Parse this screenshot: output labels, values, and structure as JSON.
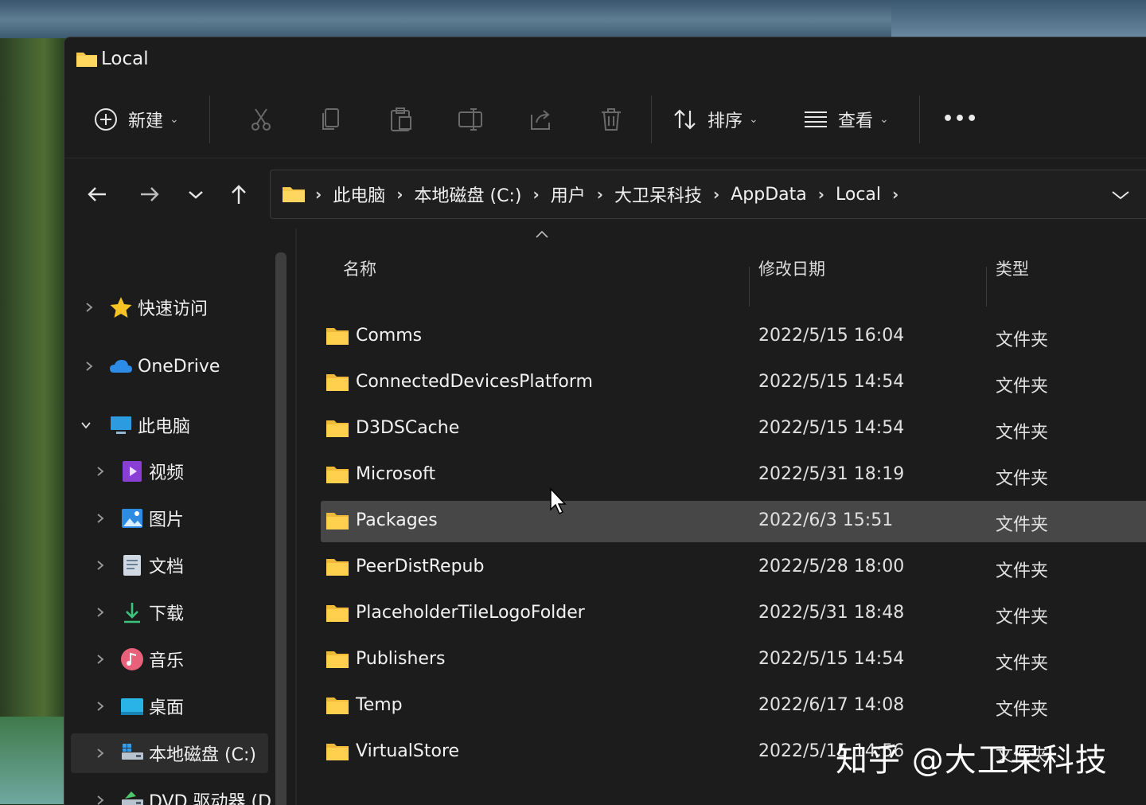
{
  "window": {
    "title": "Local"
  },
  "toolbar": {
    "new_label": "新建",
    "sort_label": "排序",
    "view_label": "查看",
    "more_label": "•••"
  },
  "address": {
    "crumbs": [
      "此电脑",
      "本地磁盘 (C:)",
      "用户",
      "大卫呆科技",
      "AppData",
      "Local"
    ]
  },
  "sidebar": {
    "items": [
      {
        "label": "快速访问",
        "icon": "star-icon"
      },
      {
        "label": "OneDrive",
        "icon": "cloud-icon"
      },
      {
        "label": "此电脑",
        "icon": "pc-icon"
      },
      {
        "label": "视频",
        "icon": "video-icon"
      },
      {
        "label": "图片",
        "icon": "pictures-icon"
      },
      {
        "label": "文档",
        "icon": "documents-icon"
      },
      {
        "label": "下载",
        "icon": "download-icon"
      },
      {
        "label": "音乐",
        "icon": "music-icon"
      },
      {
        "label": "桌面",
        "icon": "desktop-icon"
      },
      {
        "label": "本地磁盘 (C:)",
        "icon": "drive-icon"
      },
      {
        "label": "DVD 驱动器 (D",
        "icon": "dvd-icon"
      }
    ]
  },
  "columns": {
    "name": "名称",
    "modified": "修改日期",
    "type": "类型"
  },
  "files": [
    {
      "name": "Comms",
      "modified": "2022/5/15 16:04",
      "type": "文件夹"
    },
    {
      "name": "ConnectedDevicesPlatform",
      "modified": "2022/5/15 14:54",
      "type": "文件夹"
    },
    {
      "name": "D3DSCache",
      "modified": "2022/5/15 14:54",
      "type": "文件夹"
    },
    {
      "name": "Microsoft",
      "modified": "2022/5/31 18:19",
      "type": "文件夹"
    },
    {
      "name": "Packages",
      "modified": "2022/6/3 15:51",
      "type": "文件夹"
    },
    {
      "name": "PeerDistRepub",
      "modified": "2022/5/28 18:00",
      "type": "文件夹"
    },
    {
      "name": "PlaceholderTileLogoFolder",
      "modified": "2022/5/31 18:48",
      "type": "文件夹"
    },
    {
      "name": "Publishers",
      "modified": "2022/5/15 14:54",
      "type": "文件夹"
    },
    {
      "name": "Temp",
      "modified": "2022/6/17 14:08",
      "type": "文件夹"
    },
    {
      "name": "VirtualStore",
      "modified": "2022/5/15 14:56",
      "type": "文件夹"
    }
  ],
  "watermark": "知乎 @大卫呆科技",
  "colors": {
    "folder": "#f5c84c",
    "background": "#1c1c1c",
    "hover_row": "#474747"
  }
}
